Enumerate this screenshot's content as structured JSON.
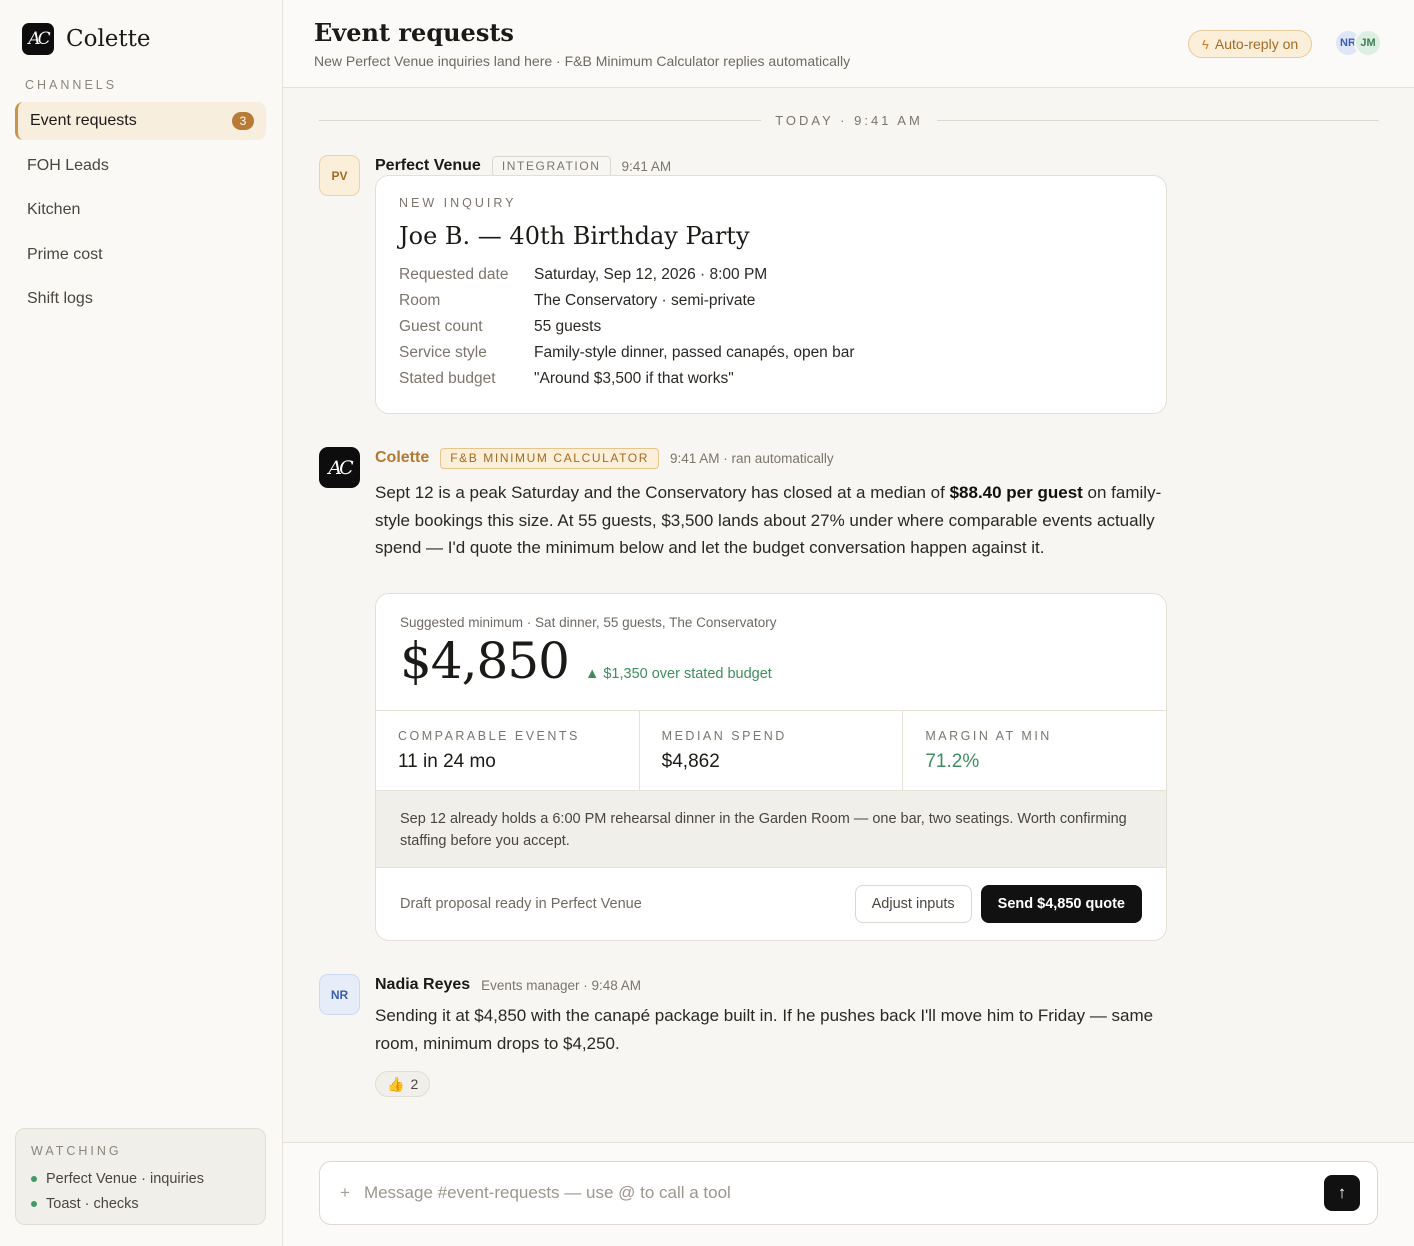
{
  "brand": {
    "logo_text": "AC",
    "name": "Colette"
  },
  "sidebar": {
    "section_label": "CHANNELS",
    "items": [
      {
        "label": "Event requests",
        "badge": "3",
        "active": true
      },
      {
        "label": "FOH Leads"
      },
      {
        "label": "Kitchen"
      },
      {
        "label": "Prime cost"
      },
      {
        "label": "Shift logs"
      }
    ],
    "watching": {
      "title": "WATCHING",
      "items": [
        "Perfect Venue · inquiries",
        "Toast · checks"
      ]
    }
  },
  "header": {
    "title": "Event requests",
    "subtitle": "New Perfect Venue inquiries land here · F&B Minimum Calculator replies automatically",
    "autoreply_label": "Auto-reply on",
    "avatars": [
      "NR",
      "JM"
    ]
  },
  "feed": {
    "divider": "TODAY · 9:41 AM",
    "messages": [
      {
        "avatar": "PV",
        "sender": "Perfect Venue",
        "tag": "INTEGRATION",
        "time": "9:41 AM",
        "inquiry": {
          "eyebrow": "NEW INQUIRY",
          "title": "Joe B. — 40th Birthday Party",
          "fields": [
            {
              "k": "Requested date",
              "v": "Saturday, Sep 12, 2026 · 8:00 PM"
            },
            {
              "k": "Room",
              "v": "The Conservatory · semi-private"
            },
            {
              "k": "Guest count",
              "v": "55 guests"
            },
            {
              "k": "Service style",
              "v": "Family-style dinner, passed canapés, open bar"
            },
            {
              "k": "Stated budget",
              "v": "\"Around $3,500 if that works\""
            }
          ]
        }
      },
      {
        "avatar": "AC",
        "sender": "Colette",
        "tag": "F&B MINIMUM CALCULATOR",
        "time": "9:41 AM · ran automatically",
        "text_before": "Sept 12 is a peak Saturday and the Conservatory has closed at a median of ",
        "text_bold": "$88.40 per guest",
        "text_after": " on family-style bookings this size. At 55 guests, $3,500 lands about 27% under where comparable events actually spend — I'd quote the minimum below and let the budget conversation happen against it.",
        "calc": {
          "label": "Suggested minimum · Sat dinner, 55 guests, The Conservatory",
          "amount": "$4,850",
          "delta_icon": "▲",
          "delta": "$1,350 over stated budget",
          "stats": [
            {
              "k": "COMPARABLE EVENTS",
              "v": "11 in 24 mo"
            },
            {
              "k": "MEDIAN SPEND",
              "v": "$4,862"
            },
            {
              "k": "MARGIN AT MIN",
              "v": "71.2%"
            }
          ],
          "note": "Sep 12 already holds a 6:00 PM rehearsal dinner in the Garden Room — one bar, two seatings. Worth confirming staffing before you accept.",
          "draft": "Draft proposal ready in Perfect Venue",
          "adjust_label": "Adjust inputs",
          "send_label": "Send $4,850 quote"
        }
      },
      {
        "avatar": "NR",
        "sender": "Nadia Reyes",
        "meta": "Events manager · 9:48 AM",
        "text": "Sending it at $4,850 with the canapé package built in. If he pushes back I'll move him to Friday — same room, minimum drops to $4,250.",
        "reaction": {
          "emoji": "👍",
          "count": "2"
        }
      }
    ]
  },
  "composer": {
    "plus": "+",
    "placeholder": "Message #event-requests — use @ to call a tool",
    "value": ""
  },
  "colors": {
    "accent": "#b87a35",
    "positive": "#3f8d5d",
    "primary_button": "#111111"
  }
}
